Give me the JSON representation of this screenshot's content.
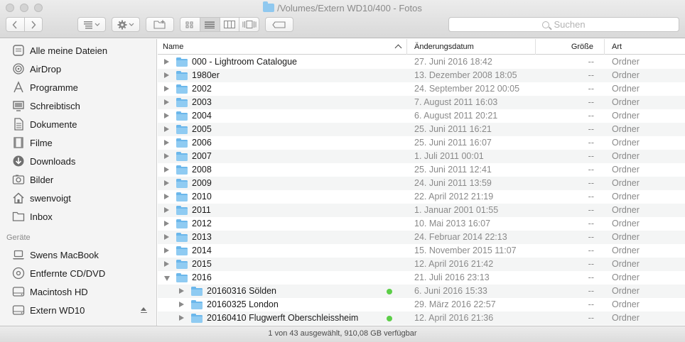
{
  "window": {
    "title": "/Volumes/Extern WD10/400 - Fotos"
  },
  "toolbar": {
    "search_placeholder": "Suchen"
  },
  "sidebar": {
    "favorites": [
      {
        "label": "Alle meine Dateien",
        "icon": "all-files-icon"
      },
      {
        "label": "AirDrop",
        "icon": "airdrop-icon"
      },
      {
        "label": "Programme",
        "icon": "applications-icon"
      },
      {
        "label": "Schreibtisch",
        "icon": "desktop-icon"
      },
      {
        "label": "Dokumente",
        "icon": "documents-icon"
      },
      {
        "label": "Filme",
        "icon": "movies-icon"
      },
      {
        "label": "Downloads",
        "icon": "downloads-icon"
      },
      {
        "label": "Bilder",
        "icon": "pictures-icon"
      },
      {
        "label": "swenvoigt",
        "icon": "home-icon"
      },
      {
        "label": "Inbox",
        "icon": "folder-icon"
      }
    ],
    "devices_header": "Geräte",
    "devices": [
      {
        "label": "Swens MacBook",
        "icon": "laptop-icon"
      },
      {
        "label": "Entfernte CD/DVD",
        "icon": "disc-icon"
      },
      {
        "label": "Macintosh HD",
        "icon": "harddisk-icon"
      },
      {
        "label": "Extern WD10",
        "icon": "external-disk-icon"
      }
    ]
  },
  "list": {
    "columns": {
      "name": "Name",
      "date": "Änderungsdatum",
      "size": "Größe",
      "kind": "Art"
    },
    "rows": [
      {
        "name": "000 - Lightroom Catalogue",
        "date": "27. Juni 2016 18:42",
        "size": "--",
        "kind": "Ordner",
        "level": 0,
        "open": false,
        "tag": false
      },
      {
        "name": "1980er",
        "date": "13. Dezember 2008 18:05",
        "size": "--",
        "kind": "Ordner",
        "level": 0,
        "open": false,
        "tag": false
      },
      {
        "name": "2002",
        "date": "24. September 2012 00:05",
        "size": "--",
        "kind": "Ordner",
        "level": 0,
        "open": false,
        "tag": false
      },
      {
        "name": "2003",
        "date": "7. August 2011 16:03",
        "size": "--",
        "kind": "Ordner",
        "level": 0,
        "open": false,
        "tag": false
      },
      {
        "name": "2004",
        "date": "6. August 2011 20:21",
        "size": "--",
        "kind": "Ordner",
        "level": 0,
        "open": false,
        "tag": false
      },
      {
        "name": "2005",
        "date": "25. Juni 2011 16:21",
        "size": "--",
        "kind": "Ordner",
        "level": 0,
        "open": false,
        "tag": false
      },
      {
        "name": "2006",
        "date": "25. Juni 2011 16:07",
        "size": "--",
        "kind": "Ordner",
        "level": 0,
        "open": false,
        "tag": false
      },
      {
        "name": "2007",
        "date": "1. Juli 2011 00:01",
        "size": "--",
        "kind": "Ordner",
        "level": 0,
        "open": false,
        "tag": false
      },
      {
        "name": "2008",
        "date": "25. Juni 2011 12:41",
        "size": "--",
        "kind": "Ordner",
        "level": 0,
        "open": false,
        "tag": false
      },
      {
        "name": "2009",
        "date": "24. Juni 2011 13:59",
        "size": "--",
        "kind": "Ordner",
        "level": 0,
        "open": false,
        "tag": false
      },
      {
        "name": "2010",
        "date": "22. April 2012 21:19",
        "size": "--",
        "kind": "Ordner",
        "level": 0,
        "open": false,
        "tag": false
      },
      {
        "name": "2011",
        "date": "1. Januar 2001 01:55",
        "size": "--",
        "kind": "Ordner",
        "level": 0,
        "open": false,
        "tag": false
      },
      {
        "name": "2012",
        "date": "10. Mai 2013 16:07",
        "size": "--",
        "kind": "Ordner",
        "level": 0,
        "open": false,
        "tag": false
      },
      {
        "name": "2013",
        "date": "24. Februar 2014 22:13",
        "size": "--",
        "kind": "Ordner",
        "level": 0,
        "open": false,
        "tag": false
      },
      {
        "name": "2014",
        "date": "15. November 2015 11:07",
        "size": "--",
        "kind": "Ordner",
        "level": 0,
        "open": false,
        "tag": false
      },
      {
        "name": "2015",
        "date": "12. April 2016 21:42",
        "size": "--",
        "kind": "Ordner",
        "level": 0,
        "open": false,
        "tag": false
      },
      {
        "name": "2016",
        "date": "21. Juli 2016 23:13",
        "size": "--",
        "kind": "Ordner",
        "level": 0,
        "open": true,
        "tag": false
      },
      {
        "name": "20160316 Sölden",
        "date": "6. Juni 2016 15:33",
        "size": "--",
        "kind": "Ordner",
        "level": 1,
        "open": false,
        "tag": true
      },
      {
        "name": "20160325 London",
        "date": "29. März 2016 22:57",
        "size": "--",
        "kind": "Ordner",
        "level": 1,
        "open": false,
        "tag": false
      },
      {
        "name": "20160410 Flugwerft Oberschleissheim",
        "date": "12. April 2016 21:36",
        "size": "--",
        "kind": "Ordner",
        "level": 1,
        "open": false,
        "tag": true
      }
    ]
  },
  "status": {
    "text": "1 von 43 ausgewählt, 910,08 GB verfügbar"
  },
  "colors": {
    "folder": "#8fcbf2",
    "tag_green": "#5cce48",
    "row_alt": "#f4f5f5"
  }
}
